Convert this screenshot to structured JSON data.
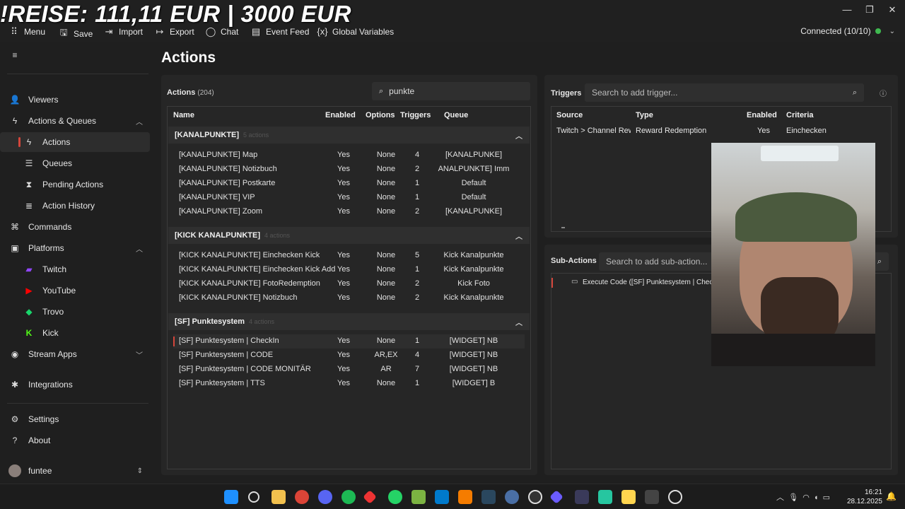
{
  "overlay": {
    "title": "!REISE: 111,11 EUR | 3000 EUR"
  },
  "window": {
    "minimize": "—",
    "maximize": "❐",
    "close": "✕"
  },
  "menubar": {
    "items": [
      {
        "label": "Menu",
        "icon": "grid-icon"
      },
      {
        "label": "Save",
        "icon": "save-icon"
      },
      {
        "label": "Import",
        "icon": "import-icon"
      },
      {
        "label": "Export",
        "icon": "export-icon"
      },
      {
        "label": "Chat",
        "icon": "chat-icon"
      },
      {
        "label": "Event Feed",
        "icon": "feed-icon"
      },
      {
        "label": "Global Variables",
        "icon": "variables-icon"
      }
    ],
    "connection": "Connected (10/10)",
    "connection_color": "#3fb950"
  },
  "sidebar": {
    "viewers": "Viewers",
    "actions_queues": "Actions & Queues",
    "actions": "Actions",
    "queues": "Queues",
    "pending_actions": "Pending Actions",
    "action_history": "Action History",
    "commands": "Commands",
    "platforms": "Platforms",
    "twitch": "Twitch",
    "youtube": "YouTube",
    "trovo": "Trovo",
    "kick": "Kick",
    "stream_apps": "Stream Apps",
    "integrations": "Integrations",
    "settings": "Settings",
    "about": "About",
    "user": "funtee"
  },
  "main": {
    "title": "Actions",
    "actions_label": "Actions",
    "actions_count": "(204)",
    "search_value": "punkte",
    "columns": [
      "Name",
      "Enabled",
      "Options",
      "Triggers",
      "Queue"
    ],
    "groups": [
      {
        "name": "[KANALPUNKTE]",
        "count": "5 actions",
        "rows": [
          {
            "name": "[KANALPUNKTE] Map",
            "enabled": "Yes",
            "options": "None",
            "triggers": "4",
            "queue": "[KANALPUNKE]"
          },
          {
            "name": "[KANALPUNKTE] Notizbuch",
            "enabled": "Yes",
            "options": "None",
            "triggers": "2",
            "queue": "ANALPUNKTE] Imm"
          },
          {
            "name": "[KANALPUNKTE] Postkarte",
            "enabled": "Yes",
            "options": "None",
            "triggers": "1",
            "queue": "Default"
          },
          {
            "name": "[KANALPUNKTE] VIP",
            "enabled": "Yes",
            "options": "None",
            "triggers": "1",
            "queue": "Default"
          },
          {
            "name": "[KANALPUNKTE] Zoom",
            "enabled": "Yes",
            "options": "None",
            "triggers": "2",
            "queue": "[KANALPUNKE]"
          }
        ]
      },
      {
        "name": "[KICK KANALPUNKTE]",
        "count": "4 actions",
        "rows": [
          {
            "name": "[KICK KANALPUNKTE] Einchecken Kick",
            "enabled": "Yes",
            "options": "None",
            "triggers": "5",
            "queue": "Kick Kanalpunkte"
          },
          {
            "name": "[KICK KANALPUNKTE] Einchecken Kick Add",
            "enabled": "Yes",
            "options": "None",
            "triggers": "1",
            "queue": "Kick Kanalpunkte"
          },
          {
            "name": "[KICK KANALPUNKTE] FotoRedemption",
            "enabled": "Yes",
            "options": "None",
            "triggers": "2",
            "queue": "Kick Foto"
          },
          {
            "name": "[KICK KANALPUNKTE] Notizbuch",
            "enabled": "Yes",
            "options": "None",
            "triggers": "2",
            "queue": "Kick Kanalpunkte"
          }
        ]
      },
      {
        "name": "[SF] Punktesystem",
        "count": "4 actions",
        "rows": [
          {
            "name": "[SF] Punktesystem | CheckIn",
            "enabled": "Yes",
            "options": "None",
            "triggers": "1",
            "queue": "[WIDGET] NB"
          },
          {
            "name": "[SF] Punktesystem | CODE",
            "enabled": "Yes",
            "options": "AR,EX",
            "triggers": "4",
            "queue": "[WIDGET] NB"
          },
          {
            "name": "[SF] Punktesystem | CODE MONITÄR",
            "enabled": "Yes",
            "options": "AR",
            "triggers": "7",
            "queue": "[WIDGET] NB"
          },
          {
            "name": "[SF] Punktesystem | TTS",
            "enabled": "Yes",
            "options": "None",
            "triggers": "1",
            "queue": "[WIDGET] B"
          }
        ]
      }
    ]
  },
  "triggers": {
    "label": "Triggers",
    "search_placeholder": "Search to add trigger...",
    "columns": [
      "Source",
      "Type",
      "Enabled",
      "Criteria"
    ],
    "rows": [
      {
        "source": "Twitch > Channel Rewa",
        "type": "Reward Redemption",
        "enabled": "Yes",
        "criteria": "Einchecken"
      }
    ]
  },
  "subactions": {
    "label": "Sub-Actions",
    "search_placeholder": "Search to add sub-action...",
    "items": [
      "Execute Code ([SF] Punktesystem | CheckIn"
    ]
  },
  "taskbar": {
    "time": "16:21",
    "date": "28.12.2025"
  }
}
